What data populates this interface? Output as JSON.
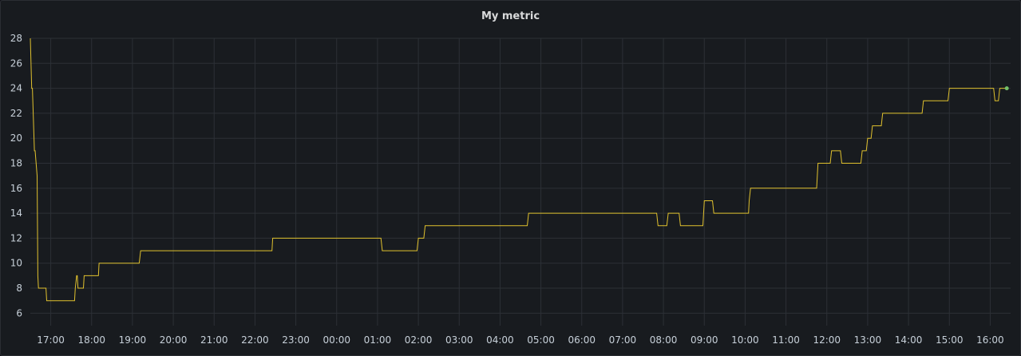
{
  "panel": {
    "title": "My metric"
  },
  "chart_data": {
    "type": "line",
    "title": "My metric",
    "xlabel": "",
    "ylabel": "",
    "x_ticks": [
      "17:00",
      "18:00",
      "19:00",
      "20:00",
      "21:00",
      "22:00",
      "23:00",
      "00:00",
      "01:00",
      "02:00",
      "03:00",
      "04:00",
      "05:00",
      "06:00",
      "07:00",
      "08:00",
      "09:00",
      "10:00",
      "11:00",
      "12:00",
      "13:00",
      "14:00",
      "15:00",
      "16:00"
    ],
    "y_ticks": [
      6,
      8,
      10,
      12,
      14,
      16,
      18,
      20,
      22,
      24,
      26,
      28
    ],
    "ylim": [
      5,
      28
    ],
    "xlim": [
      "16:30",
      "16:30 (+1d)"
    ],
    "grid": true,
    "series": [
      {
        "line_color": "#e0c12e",
        "end_marker_color": "#73bf69",
        "points": [
          [
            "16:30",
            28
          ],
          [
            "16:32",
            24
          ],
          [
            "16:33",
            24
          ],
          [
            "16:36",
            19
          ],
          [
            "16:37",
            19
          ],
          [
            "16:40",
            17
          ],
          [
            "16:41",
            9
          ],
          [
            "16:42",
            8
          ],
          [
            "16:53",
            8
          ],
          [
            "16:54",
            7
          ],
          [
            "17:35",
            7
          ],
          [
            "17:36",
            8
          ],
          [
            "17:38",
            9
          ],
          [
            "17:39",
            9
          ],
          [
            "17:40",
            8
          ],
          [
            "17:42",
            8
          ],
          [
            "17:48",
            8
          ],
          [
            "17:49",
            9
          ],
          [
            "18:10",
            9
          ],
          [
            "18:11",
            10
          ],
          [
            "19:10",
            10
          ],
          [
            "19:12",
            11
          ],
          [
            "22:25",
            11
          ],
          [
            "22:26",
            12
          ],
          [
            "01:05",
            12
          ],
          [
            "01:07",
            11
          ],
          [
            "01:58",
            11
          ],
          [
            "02:00",
            12
          ],
          [
            "02:08",
            12
          ],
          [
            "02:10",
            13
          ],
          [
            "04:40",
            13
          ],
          [
            "04:42",
            14
          ],
          [
            "07:50",
            14
          ],
          [
            "07:52",
            13
          ],
          [
            "08:05",
            13
          ],
          [
            "08:07",
            14
          ],
          [
            "08:23",
            14
          ],
          [
            "08:25",
            13
          ],
          [
            "08:58",
            13
          ],
          [
            "09:00",
            15
          ],
          [
            "09:12",
            15
          ],
          [
            "09:14",
            14
          ],
          [
            "10:05",
            14
          ],
          [
            "10:06",
            15
          ],
          [
            "10:08",
            16
          ],
          [
            "11:45",
            16
          ],
          [
            "11:47",
            18
          ],
          [
            "12:05",
            18
          ],
          [
            "12:07",
            19
          ],
          [
            "12:20",
            19
          ],
          [
            "12:22",
            18
          ],
          [
            "12:50",
            18
          ],
          [
            "12:52",
            19
          ],
          [
            "12:58",
            19
          ],
          [
            "13:00",
            20
          ],
          [
            "13:05",
            20
          ],
          [
            "13:07",
            21
          ],
          [
            "13:20",
            21
          ],
          [
            "13:22",
            22
          ],
          [
            "14:20",
            22
          ],
          [
            "14:22",
            23
          ],
          [
            "14:58",
            23
          ],
          [
            "15:00",
            24
          ],
          [
            "16:05",
            24
          ],
          [
            "16:07",
            23
          ],
          [
            "16:12",
            23
          ],
          [
            "16:14",
            24
          ],
          [
            "16:22",
            24
          ]
        ]
      }
    ]
  }
}
